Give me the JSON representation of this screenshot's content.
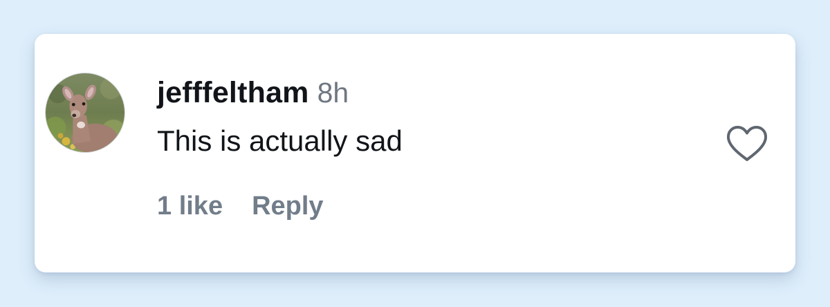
{
  "comment": {
    "username": "jefffeltham",
    "timestamp": "8h",
    "text": "This is actually sad",
    "likes_label": "1 like",
    "reply_label": "Reply",
    "like_icon": "heart-outline-icon",
    "avatar_icon": "deer-photo"
  },
  "colors": {
    "background": "#deeefb",
    "card": "#ffffff",
    "primary_text": "#111418",
    "secondary_text": "#6f7782",
    "action_text": "#727d8a",
    "heart_stroke": "#5f6670"
  }
}
